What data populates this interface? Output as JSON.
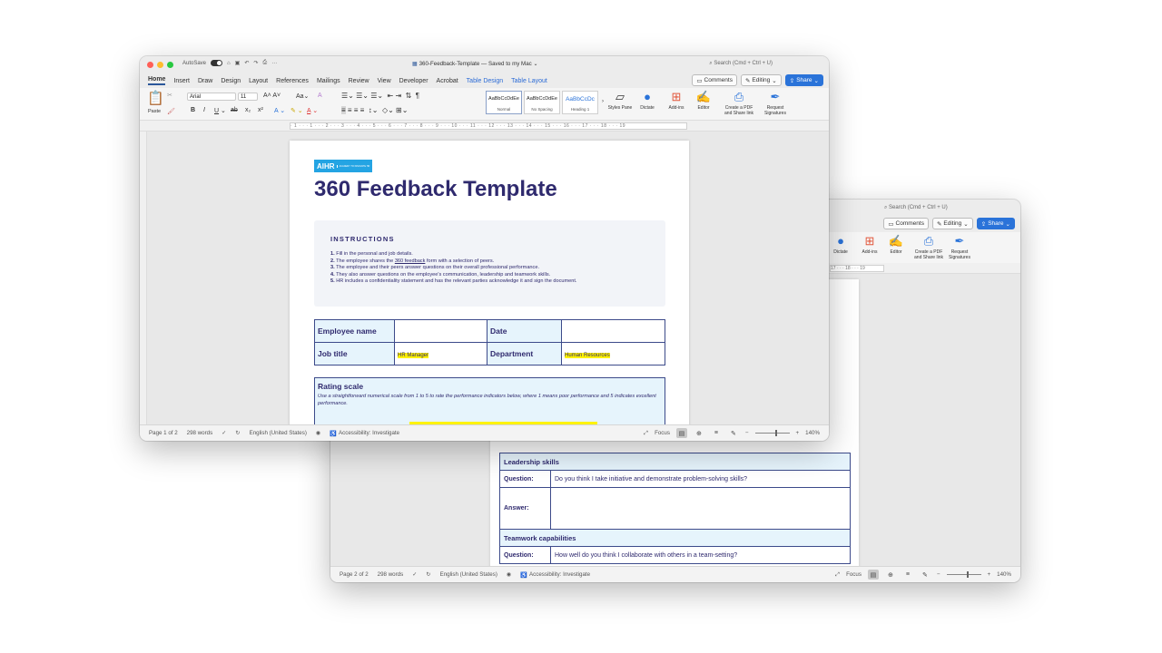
{
  "front": {
    "title": "360-Feedback-Template — Saved to my Mac ⌄",
    "autosave": "AutoSave",
    "search": "Search (Cmd + Ctrl + U)",
    "tabs": [
      "Home",
      "Insert",
      "Draw",
      "Design",
      "Layout",
      "References",
      "Mailings",
      "Review",
      "View",
      "Developer",
      "Acrobat",
      "Table Design",
      "Table Layout"
    ],
    "comments": "Comments",
    "editing": "Editing",
    "share": "Share",
    "ribbon": {
      "paste": "Paste",
      "font": "Arial",
      "size": "11",
      "styles": [
        {
          "sample": "AaBbCcDdEe",
          "name": "Normal"
        },
        {
          "sample": "AaBbCcDdEe",
          "name": "No Spacing"
        },
        {
          "sample": "AaBbCcDc",
          "name": "Heading 1"
        }
      ],
      "styles_pane": "Styles Pane",
      "dictate": "Dictate",
      "addins": "Add-ins",
      "editor": "Editor",
      "pdf": "Create a PDF and Share link",
      "sign": "Request Signatures"
    },
    "ruler": "· 1 · · · 1 · · · 2 · · · 3 · · · 4 · · · 5 · · · 6 · · · 7 · · · 8 · · · 9 · · · 10 · · · 11 · · · 12 · · · 13 · · · 14 · · · 15 · · · 16 · · · 17 · · · 18 · · · 19",
    "status": {
      "page": "Page 1 of 2",
      "words": "298 words",
      "language": "English (United States)",
      "accessibility": "Accessibility: Investigate",
      "focus": "Focus",
      "zoom": "140%"
    },
    "doc": {
      "logo": "AIHR",
      "logo_sub": "ACADEMY TO INNOVATE HR",
      "heading": "360 Feedback Template",
      "instructions_title": "INSTRUCTIONS",
      "instructions": [
        {
          "num": "1.",
          "pre": "Fill in the personal and job details.",
          "link": "",
          "post": ""
        },
        {
          "num": "2.",
          "pre": "The employee shares the ",
          "link": "360 feedback",
          "post": " form with a selection of peers."
        },
        {
          "num": "3.",
          "pre": "The employee and their peers answer questions on their overall professional performance.",
          "link": "",
          "post": ""
        },
        {
          "num": "4.",
          "pre": "They also answer questions on the employee's communication, leadership and teamwork skills.",
          "link": "",
          "post": ""
        },
        {
          "num": "5.",
          "pre": "HR includes a confidentiality statement and has the relevant parties acknowledge it and sign the document.",
          "link": "",
          "post": ""
        }
      ],
      "employee_name_label": "Employee name",
      "date_label": "Date",
      "job_title_label": "Job title",
      "job_title_value": "HR Manager",
      "department_label": "Department",
      "department_value": "Human Resources",
      "rating_title": "Rating scale",
      "rating_desc": "Use a straightforward numerical scale from 1 to 5 to rate the performance indicators below, where 1 means poor performance and 5 indicates excellent performance."
    }
  },
  "back": {
    "search": "Search (Cmd + Ctrl + U)",
    "comments": "Comments",
    "editing": "Editing",
    "share": "Share",
    "ribbon": {
      "dictate": "Dictate",
      "addins": "Add-ins",
      "editor": "Editor",
      "pdf": "Create a PDF and Share link",
      "sign": "Request Signatures"
    },
    "ruler": "17 · · · 18 · · · 19",
    "sections": [
      {
        "title": "Leadership skills",
        "question_label": "Question:",
        "question": "Do you think I take initiative and demonstrate problem-solving skills?",
        "answer_label": "Answer:"
      },
      {
        "title": "Teamwork capabilities",
        "question_label": "Question:",
        "question": "How well do you think I collaborate with others in a team-setting?",
        "answer_label": ""
      }
    ],
    "status": {
      "page": "Page 2 of 2",
      "words": "298 words",
      "language": "English (United States)",
      "accessibility": "Accessibility: Investigate",
      "focus": "Focus",
      "zoom": "140%"
    }
  }
}
